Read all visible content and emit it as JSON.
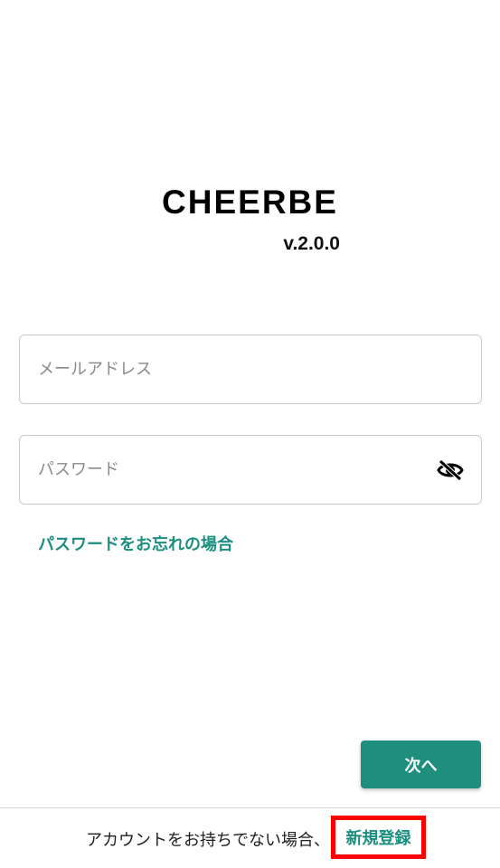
{
  "app": {
    "logo_text": "CHEERBE",
    "version": "v.2.0.0"
  },
  "login_form": {
    "email_placeholder": "メールアドレス",
    "email_value": "",
    "password_placeholder": "パスワード",
    "password_value": "",
    "password_toggle_icon": "eye-slash-icon",
    "forgot_password_label": "パスワードをお忘れの場合"
  },
  "actions": {
    "next_label": "次へ"
  },
  "footer": {
    "prompt_text": "アカウントをお持ちでない場合、",
    "signup_label": "新規登録"
  },
  "colors": {
    "accent": "#1e8f7f",
    "highlight_border": "#ff0000"
  }
}
